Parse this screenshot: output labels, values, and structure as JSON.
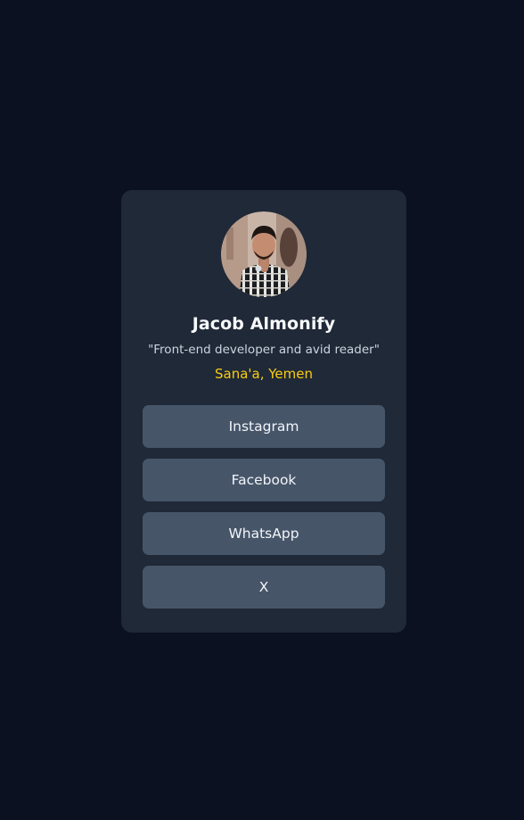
{
  "profile": {
    "name": "Jacob Almonify",
    "bio": "\"Front-end developer and avid reader\"",
    "location": "Sana'a, Yemen",
    "avatar_icon": "profile-photo"
  },
  "links": [
    {
      "label": "Instagram"
    },
    {
      "label": "Facebook"
    },
    {
      "label": "WhatsApp"
    },
    {
      "label": "X"
    }
  ],
  "colors": {
    "page_background": "#0b1120",
    "card_background": "#1f2937",
    "button_background": "#475569",
    "location_accent": "#facc15",
    "name_text": "#f8fafc",
    "bio_text": "#cbd5e1"
  }
}
